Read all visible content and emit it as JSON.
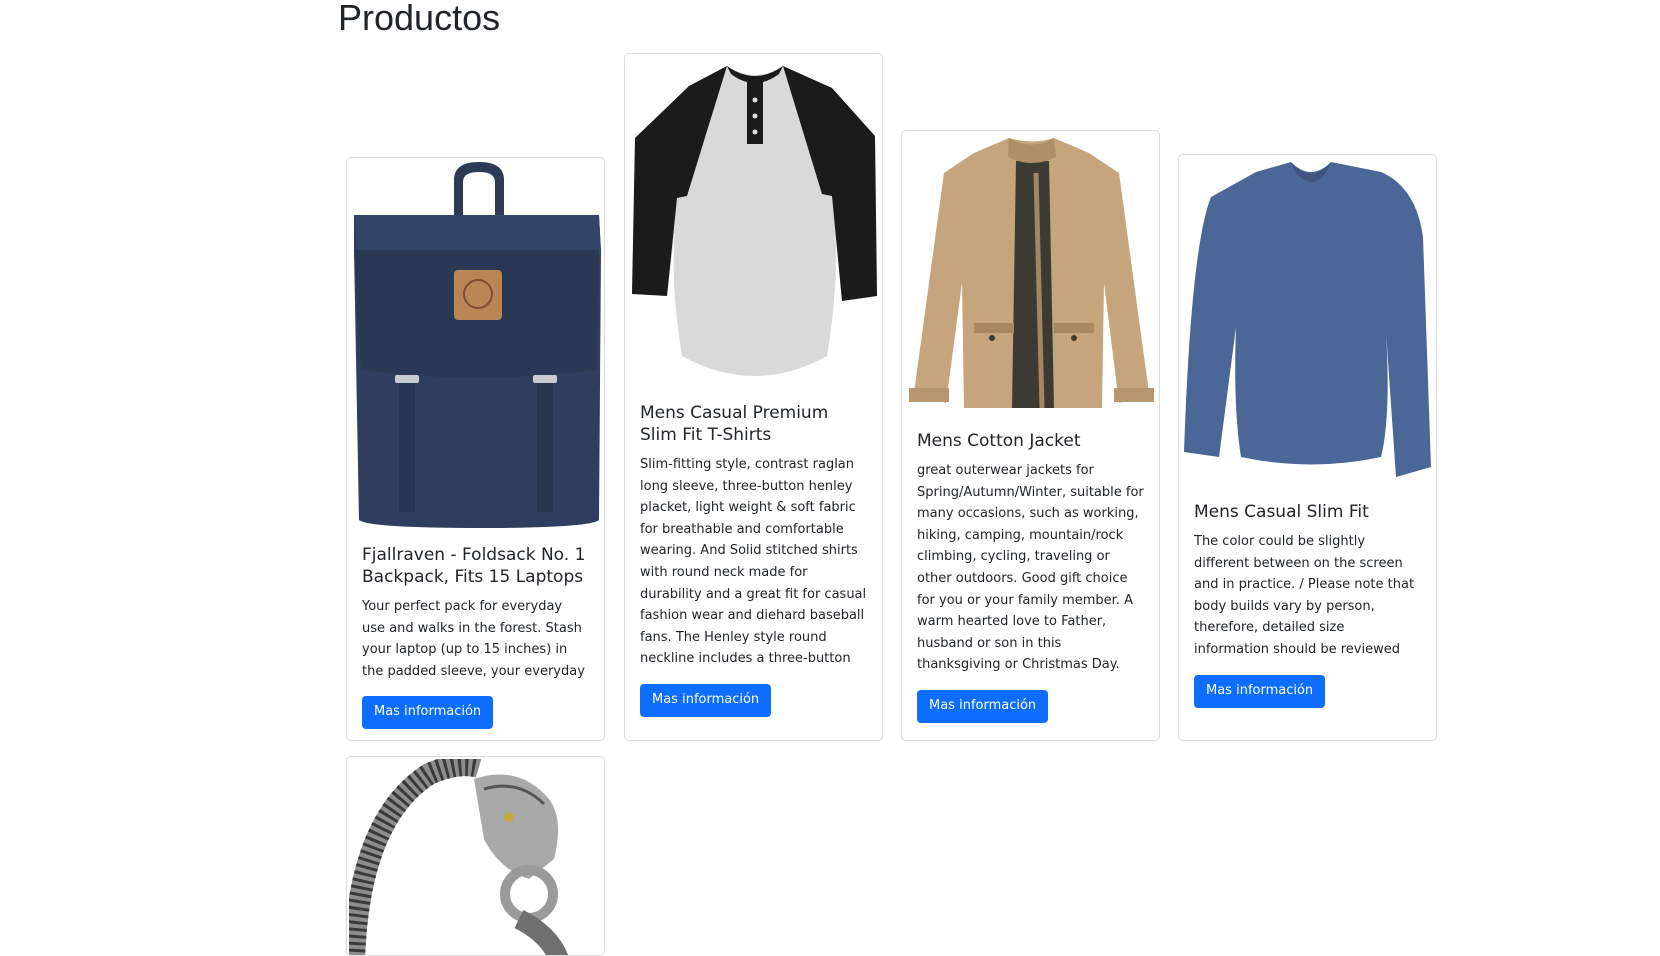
{
  "page": {
    "title": "Productos"
  },
  "products": [
    {
      "title": "Fjallraven - Foldsack No. 1 Backpack, Fits 15 Laptops",
      "description": "Your perfect pack for everyday use and walks in the forest. Stash your laptop (up to 15 inches) in the padded sleeve, your everyday",
      "button_label": "Mas información",
      "image": "navy-backpack"
    },
    {
      "title": "Mens Casual Premium Slim Fit T-Shirts",
      "description": "Slim-fitting style, contrast raglan long sleeve, three-button henley placket, light weight & soft fabric for breathable and comfortable wearing. And Solid stitched shirts with round neck made for durability and a great fit for casual fashion wear and diehard baseball fans. The Henley style round neckline includes a three-button placket.",
      "button_label": "Mas información",
      "image": "raglan-henley-shirt"
    },
    {
      "title": "Mens Cotton Jacket",
      "description": "great outerwear jackets for Spring/Autumn/Winter, suitable for many occasions, such as working, hiking, camping, mountain/rock climbing, cycling, traveling or other outdoors. Good gift choice for you or your family member. A warm hearted love to Father, husband or son in this thanksgiving or Christmas Day.",
      "button_label": "Mas información",
      "image": "khaki-jacket"
    },
    {
      "title": "Mens Casual Slim Fit",
      "description": "The color could be slightly different between on the screen and in practice. / Please note that body builds vary by person, therefore, detailed size information should be reviewed below on the product description.",
      "button_label": "Mas información",
      "image": "blue-long-sleeve-shirt"
    },
    {
      "title": "",
      "description": "",
      "button_label": "",
      "image": "silver-dragon-bracelet"
    }
  ],
  "colors": {
    "button": "#0d6efd",
    "border": "#dcdcdc"
  }
}
